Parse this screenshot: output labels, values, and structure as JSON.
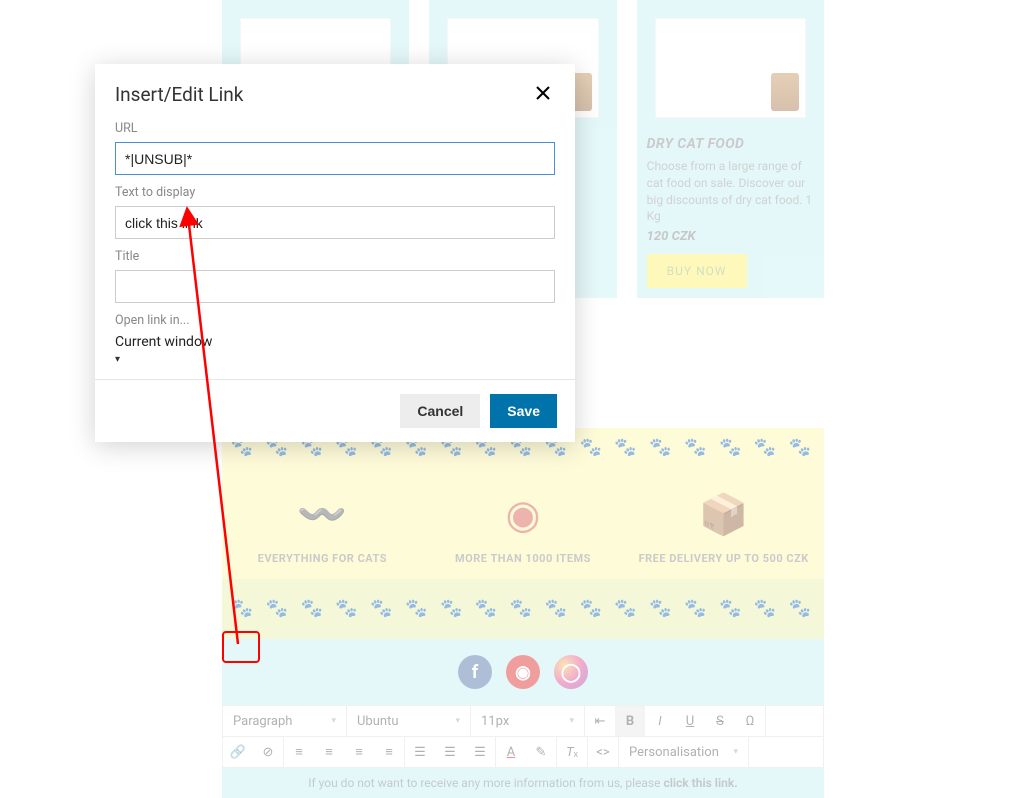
{
  "modal": {
    "title": "Insert/Edit Link",
    "url_label": "URL",
    "url_value": "*|UNSUB|*",
    "text_label": "Text to display",
    "text_value": "click this link",
    "title_label": "Title",
    "title_value": "",
    "open_label": "Open link in...",
    "open_value": "Current window",
    "cancel": "Cancel",
    "save": "Save"
  },
  "product": {
    "title": "DRY CAT FOOD",
    "desc": "Choose from a large range of cat food on sale. Discover our big discounts of dry cat food. 1 Kg",
    "price": "120 CZK",
    "buy": "BUY NOW"
  },
  "features": {
    "a": "EVERYTHING FOR CATS",
    "b": "MORE THAN 1000 ITEMS",
    "c": "FREE DELIVERY UP TO 500 CZK"
  },
  "toolbar": {
    "format": "Paragraph",
    "font": "Ubuntu",
    "size": "11px",
    "personalisation": "Personalisation"
  },
  "footer": {
    "prefix": "If you do not want to receive any more information from us, please ",
    "link": "click this link.",
    "paws": "🐾 🐾 🐾 🐾 🐾 🐾 🐾 🐾 🐾 🐾 🐾 🐾 🐾 🐾 🐾 🐾 🐾 🐾 🐾 🐾"
  }
}
